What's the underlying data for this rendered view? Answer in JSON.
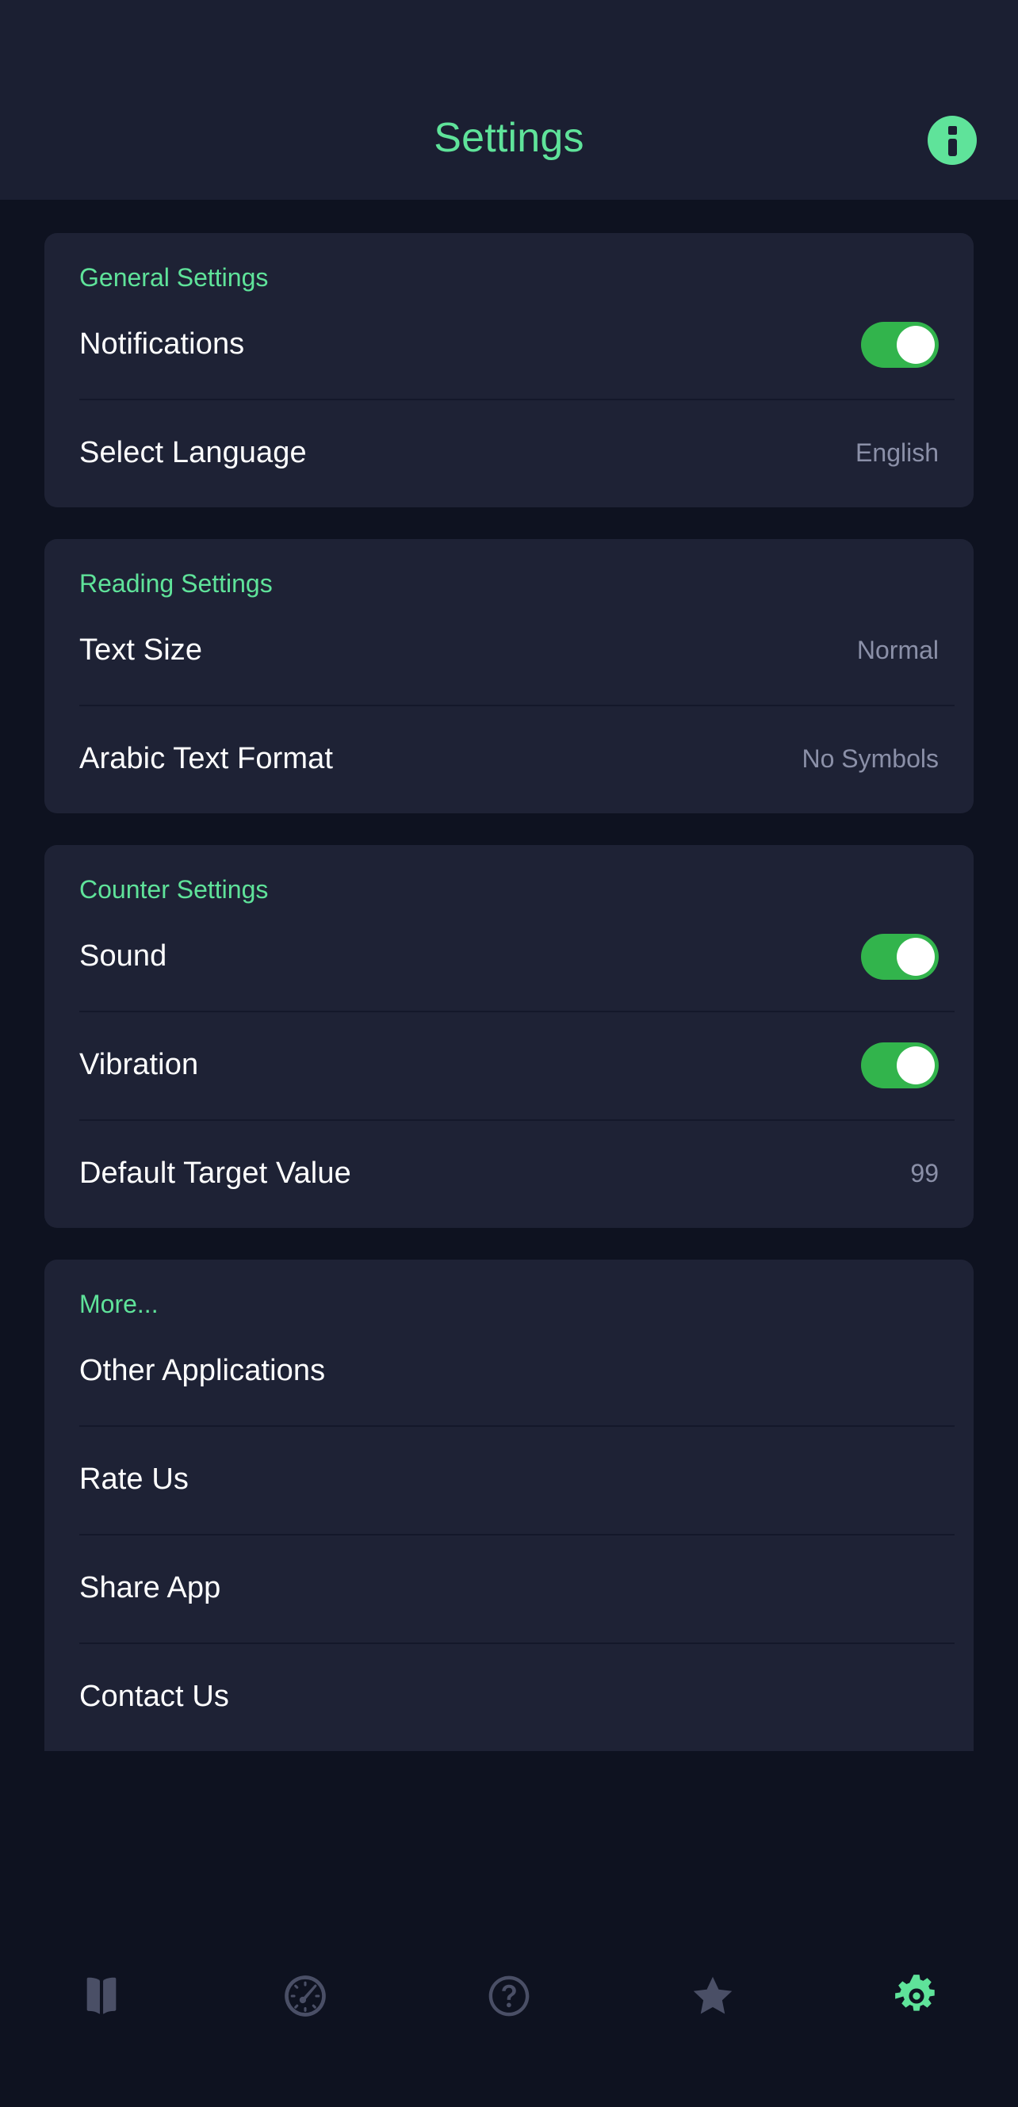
{
  "header": {
    "title": "Settings",
    "info_icon": "info-icon"
  },
  "colors": {
    "accent_green": "#5fe39a",
    "toggle_on": "#32b44c",
    "page_bg": "#0e1220",
    "card_bg": "#1e2235",
    "appbar_bg": "#1b1f32",
    "label": "#ffffff",
    "value": "#8b90a8",
    "nav_inactive": "#4a4f66"
  },
  "sections": [
    {
      "id": "general-settings",
      "title": "General Settings",
      "rows": [
        {
          "id": "notifications",
          "label": "Notifications",
          "control": "toggle",
          "value": "on"
        },
        {
          "id": "select-language",
          "label": "Select Language",
          "control": "value",
          "value": "English"
        }
      ]
    },
    {
      "id": "reading-settings",
      "title": "Reading Settings",
      "rows": [
        {
          "id": "text-size",
          "label": "Text Size",
          "control": "value",
          "value": "Normal"
        },
        {
          "id": "arabic-text-format",
          "label": "Arabic Text Format",
          "control": "value",
          "value": "No Symbols"
        }
      ]
    },
    {
      "id": "counter-settings",
      "title": "Counter Settings",
      "rows": [
        {
          "id": "sound",
          "label": "Sound",
          "control": "toggle",
          "value": "on"
        },
        {
          "id": "vibration",
          "label": "Vibration",
          "control": "toggle",
          "value": "on"
        },
        {
          "id": "default-target-value",
          "label": "Default Target Value",
          "control": "value",
          "value": "99"
        }
      ]
    },
    {
      "id": "more",
      "title": "More...",
      "rows": [
        {
          "id": "other-applications",
          "label": "Other Applications",
          "control": "none",
          "value": ""
        },
        {
          "id": "rate-us",
          "label": "Rate Us",
          "control": "none",
          "value": ""
        },
        {
          "id": "share-app",
          "label": "Share App",
          "control": "none",
          "value": ""
        },
        {
          "id": "contact-us",
          "label": "Contact Us",
          "control": "none",
          "value": ""
        }
      ]
    }
  ],
  "bottom_nav": {
    "items": [
      {
        "id": "book",
        "icon": "book-icon",
        "active": false
      },
      {
        "id": "gauge",
        "icon": "gauge-icon",
        "active": false
      },
      {
        "id": "help",
        "icon": "question-circle-icon",
        "active": false
      },
      {
        "id": "favorites",
        "icon": "star-icon",
        "active": false
      },
      {
        "id": "settings",
        "icon": "gear-icon",
        "active": true
      }
    ]
  }
}
